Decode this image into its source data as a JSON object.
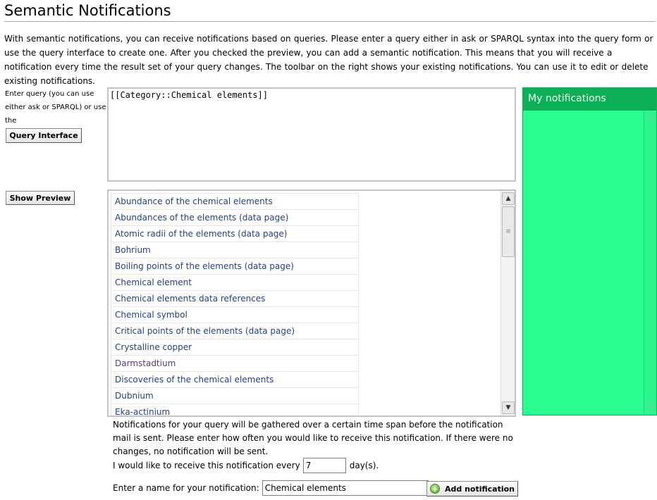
{
  "page": {
    "title": "Semantic Notifications",
    "intro": "With semantic notifications, you can receive notifications based on queries. Please enter a query either in ask or SPARQL syntax into the query form or use the query interface to create one. After you checked the preview, you can add a semantic notification. This means that you will receive a notification every time the result set of your query changes. The toolbar on the right shows your existing notifications. You can use it to edit or delete existing notifications."
  },
  "query": {
    "label": "Enter query (you can use either ask or SPARQL) or use the",
    "interface_button": "Query Interface",
    "value": "[[Category::Chemical elements]]"
  },
  "preview": {
    "button": "Show Preview",
    "results": [
      "Abundance of the chemical elements",
      "Abundances of the elements (data page)",
      "Atomic radii of the elements (data page)",
      "Bohrium",
      "Boiling points of the elements (data page)",
      "Chemical element",
      "Chemical elements data references",
      "Chemical symbol",
      "Critical points of the elements (data page)",
      "Crystalline copper",
      "Darmstadtium",
      "Discoveries of the chemical elements",
      "Dubnium",
      "Eka-actinium"
    ]
  },
  "sidebar": {
    "title": "My notifications"
  },
  "settings": {
    "info": "Notifications for your query will be gathered over a certain time span before the notification mail is sent. Please enter how often you would like to receive this notification. If there were no changes, no notification will be sent.",
    "interval_prefix": "I would like to receive this notification every",
    "interval_value": "7",
    "interval_suffix": "day(s).",
    "name_label": "Enter a name for your notification:",
    "name_value": "Chemical elements",
    "add_button": "Add notification"
  },
  "colors": {
    "link": "#23408e",
    "visited_link": "#5a3696",
    "panel_bg": "#29fd8e",
    "panel_header": "#0db057"
  },
  "icons": {
    "add": "plus-circle-icon",
    "scroll_up": "arrow-up-icon",
    "scroll_down": "arrow-down-icon"
  }
}
